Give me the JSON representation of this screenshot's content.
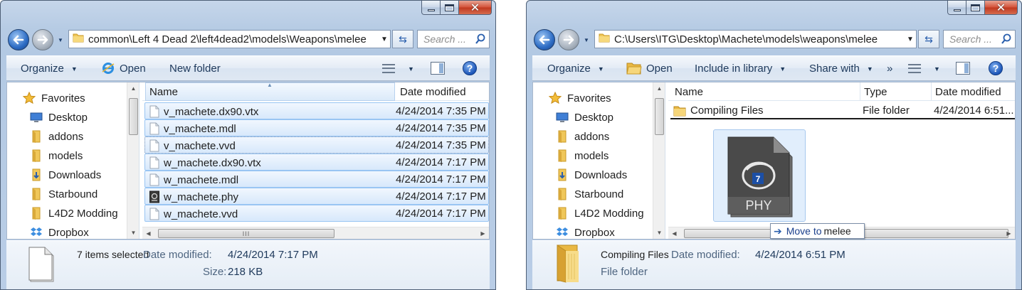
{
  "left_window": {
    "address_path": "common\\Left 4 Dead 2\\left4dead2\\models\\Weapons\\melee",
    "search_placeholder": "Search ...",
    "toolbar": {
      "organize": "Organize",
      "open": "Open",
      "new_folder": "New folder"
    },
    "nav_items": [
      {
        "label": "Favorites",
        "icon": "star-icon"
      },
      {
        "label": "Desktop",
        "icon": "desktop-icon"
      },
      {
        "label": "addons",
        "icon": "folder-icon"
      },
      {
        "label": "models",
        "icon": "folder-icon"
      },
      {
        "label": "Downloads",
        "icon": "downloads-folder-icon"
      },
      {
        "label": "Starbound",
        "icon": "folder-icon"
      },
      {
        "label": "L4D2 Modding",
        "icon": "folder-icon"
      },
      {
        "label": "Dropbox",
        "icon": "dropbox-icon"
      }
    ],
    "columns": {
      "name": "Name",
      "date_modified": "Date modified"
    },
    "files": [
      {
        "name": "v_machete.dx90.vtx",
        "date": "4/24/2014 7:35 PM",
        "icon": "file-icon"
      },
      {
        "name": "v_machete.mdl",
        "date": "4/24/2014 7:35 PM",
        "icon": "file-icon"
      },
      {
        "name": "v_machete.vvd",
        "date": "4/24/2014 7:35 PM",
        "icon": "file-icon"
      },
      {
        "name": "w_machete.dx90.vtx",
        "date": "4/24/2014 7:17 PM",
        "icon": "file-icon"
      },
      {
        "name": "w_machete.mdl",
        "date": "4/24/2014 7:17 PM",
        "icon": "file-icon"
      },
      {
        "name": "w_machete.phy",
        "date": "4/24/2014 7:17 PM",
        "icon": "phy-file-icon"
      },
      {
        "name": "w_machete.vvd",
        "date": "4/24/2014 7:17 PM",
        "icon": "file-icon"
      }
    ],
    "details": {
      "selection_count": "7 items selected",
      "date_label": "Date modified:",
      "date_value": "4/24/2014 7:17 PM",
      "size_label": "Size:",
      "size_value": "218 KB"
    }
  },
  "right_window": {
    "address_path": "C:\\Users\\ITG\\Desktop\\Machete\\models\\weapons\\melee",
    "search_placeholder": "Search ...",
    "toolbar": {
      "organize": "Organize",
      "open": "Open",
      "include_in_library": "Include in library",
      "share_with": "Share with",
      "more": "»"
    },
    "nav_items": [
      {
        "label": "Favorites",
        "icon": "star-icon"
      },
      {
        "label": "Desktop",
        "icon": "desktop-icon"
      },
      {
        "label": "addons",
        "icon": "folder-icon"
      },
      {
        "label": "models",
        "icon": "folder-icon"
      },
      {
        "label": "Downloads",
        "icon": "downloads-folder-icon"
      },
      {
        "label": "Starbound",
        "icon": "folder-icon"
      },
      {
        "label": "L4D2 Modding",
        "icon": "folder-icon"
      },
      {
        "label": "Dropbox",
        "icon": "dropbox-icon"
      }
    ],
    "columns": {
      "name": "Name",
      "type": "Type",
      "date_modified": "Date modified"
    },
    "files": [
      {
        "name": "Compiling Files",
        "type": "File folder",
        "date": "4/24/2014 6:51...",
        "icon": "folder-icon"
      }
    ],
    "drag": {
      "file_label": "PHY",
      "badge": "7",
      "tooltip_arrow": "➔",
      "tooltip_action": "Move to",
      "tooltip_target": "melee"
    },
    "details": {
      "name": "Compiling Files",
      "date_label": "Date modified:",
      "date_value": "4/24/2014 6:51 PM",
      "type_value": "File folder"
    }
  },
  "colors": {
    "window_frame": "#b9cde6",
    "selection": "#d7e8fb",
    "selection_border": "#99c5f3",
    "accent_blue": "#2a5fad",
    "close_red": "#c0381f"
  }
}
